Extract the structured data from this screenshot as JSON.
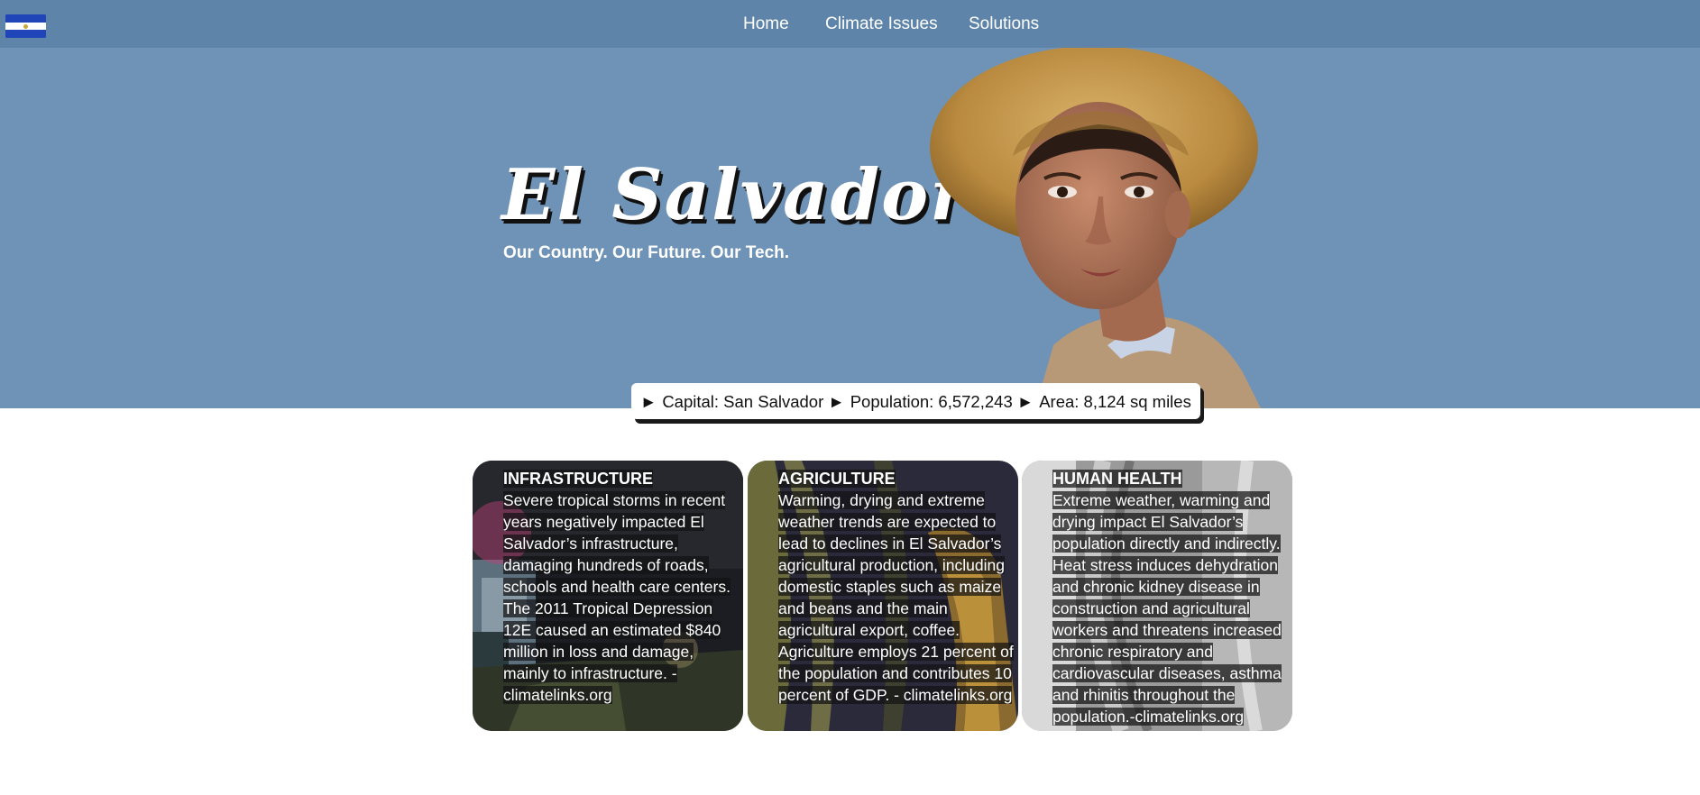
{
  "nav": {
    "items": [
      {
        "label": "Home"
      },
      {
        "label": "Climate Issues"
      },
      {
        "label": "Solutions"
      }
    ]
  },
  "hero": {
    "title": "El Salvador",
    "tagline": "Our Country. Our Future. Our Tech."
  },
  "stats": {
    "capital": "Capital: San Salvador",
    "population": "Population: 6,572,243",
    "area": "Area: 8,124 sq miles",
    "arrow": "►"
  },
  "cards": [
    {
      "title": "INFRASTRUCTURE",
      "body": "Severe tropical storms in recent years negatively impacted El Salvador’s infrastructure, damaging hundreds of roads, schools and health care centers. The 2011 Tropical Depression 12E caused an estimated $840 million in loss and damage, mainly to infrastructure. - climatelinks.org"
    },
    {
      "title": "AGRICULTURE",
      "body": "Warming, drying and extreme weather trends are expected to lead to declines in El Salvador’s agricultural production, including domestic staples such as maize and beans and the main agricultural export, coffee. Agriculture employs 21 percent of the population and contributes 10 percent of GDP. - climatelinks.org"
    },
    {
      "title": "HUMAN HEALTH",
      "body": "Extreme weather, warming and drying impact El Salvador’s population directly and indirectly. Heat stress induces dehydration and chronic kidney disease in construction and agricultural workers and threatens increased chronic respiratory and cardiovascular diseases, asthma and rhinitis throughout the population.-climatelinks.org"
    }
  ],
  "colors": {
    "nav_bg": "#5e84aa",
    "hero_bg": "#6f93b6",
    "card_text_bg": "#121214"
  }
}
